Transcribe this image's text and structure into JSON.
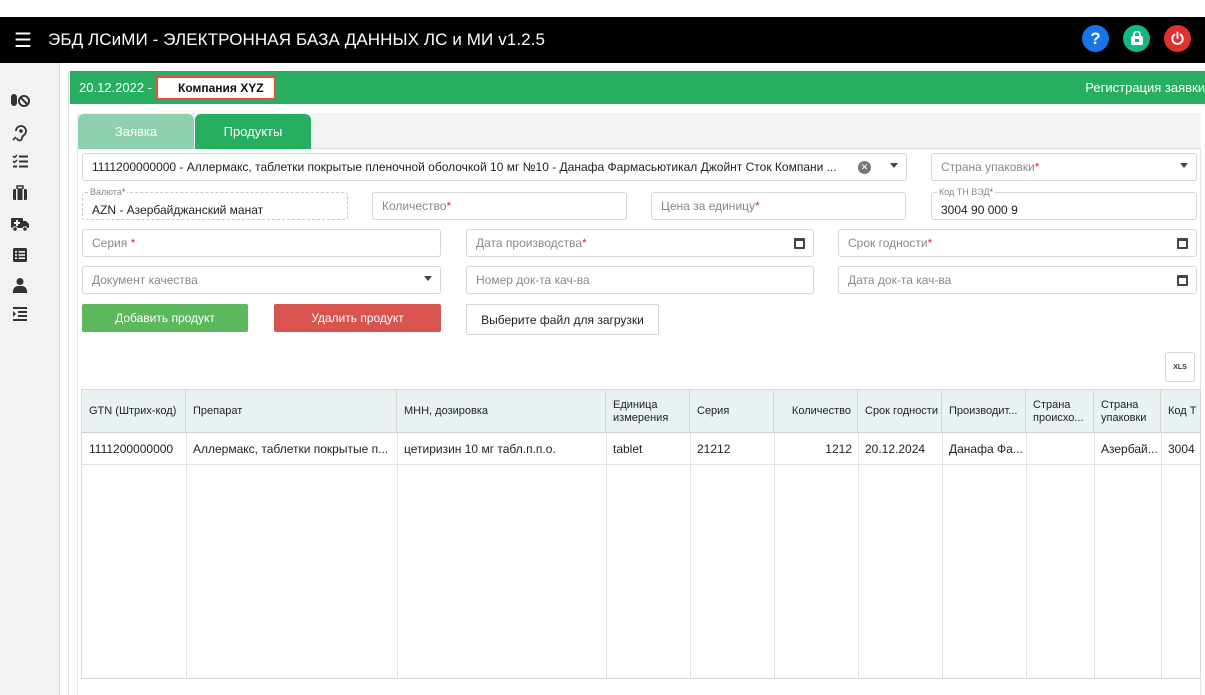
{
  "topbar": {
    "title": "ЭБД ЛСиМИ - ЭЛЕКТРОННАЯ БАЗА ДАННЫХ ЛС и МИ v1.2.5",
    "help_glyph": "?",
    "icons": [
      "menu-icon",
      "help-icon",
      "shop-icon",
      "power-icon"
    ]
  },
  "sidebar": {
    "icons": [
      "pills-icon",
      "hearing-icon",
      "checklist-icon",
      "suitcase-icon",
      "ambulance-icon",
      "list-icon",
      "user-icon",
      "indent-list-icon"
    ]
  },
  "header": {
    "date": "20.12.2022 -",
    "company": "Компания XYZ",
    "action": "Регистрация заявки"
  },
  "tabs": [
    {
      "label": "Заявка"
    },
    {
      "label": "Продукты"
    }
  ],
  "form": {
    "product": "1111200000000 -  Аллермакс, таблетки покрытые пленочной оболочкой 10 мг №10 - Данафа Фармасьютикал Джойнт Сток Компани ...",
    "packing_country": {
      "placeholder": "Страна упаковки",
      "required": "*"
    },
    "currency": {
      "label": "Валюта",
      "required": "*",
      "value": "AZN - Азербайджанский манат"
    },
    "quantity": {
      "placeholder": "Количество",
      "required": "*"
    },
    "unit_price": {
      "placeholder": "Цена за единицу",
      "required": "*"
    },
    "hs_code": {
      "label": "Код ТН ВЭД",
      "required": "*",
      "value": "3004 90 000 9"
    },
    "series": {
      "placeholder": "Серия",
      "required": "*"
    },
    "production_date": {
      "placeholder": "Дата производства",
      "required": "*"
    },
    "expiry_date": {
      "placeholder": "Срок годности",
      "required": "*"
    },
    "quality_doc": {
      "placeholder": "Документ качества"
    },
    "quality_doc_number": {
      "placeholder": "Номер док-та кач-ва"
    },
    "quality_doc_date": {
      "placeholder": "Дата док-та кач-ва"
    }
  },
  "buttons": {
    "add": "Добавить продукт",
    "delete": "Удалить продукт",
    "file": "Выберите файл для загрузки",
    "export_glyph": "XLS"
  },
  "table": {
    "columns": [
      "GTN (Штрих-код)",
      "Препарат",
      "МНН, дозировка",
      "Единица измерения",
      "Серия",
      "Количество",
      "Срок годности",
      "Производит...",
      "Страна происхо...",
      "Страна упаковки",
      "Код Т"
    ],
    "rows": [
      [
        "1111200000000",
        "Аллермакс, таблетки покрытые п...",
        "цетиризин 10 мг табл.п.п.о.",
        "tablet",
        "21212",
        "1212",
        "20.12.2024",
        "Данафа Фа...",
        "",
        "Азербай...",
        "3004"
      ]
    ]
  }
}
